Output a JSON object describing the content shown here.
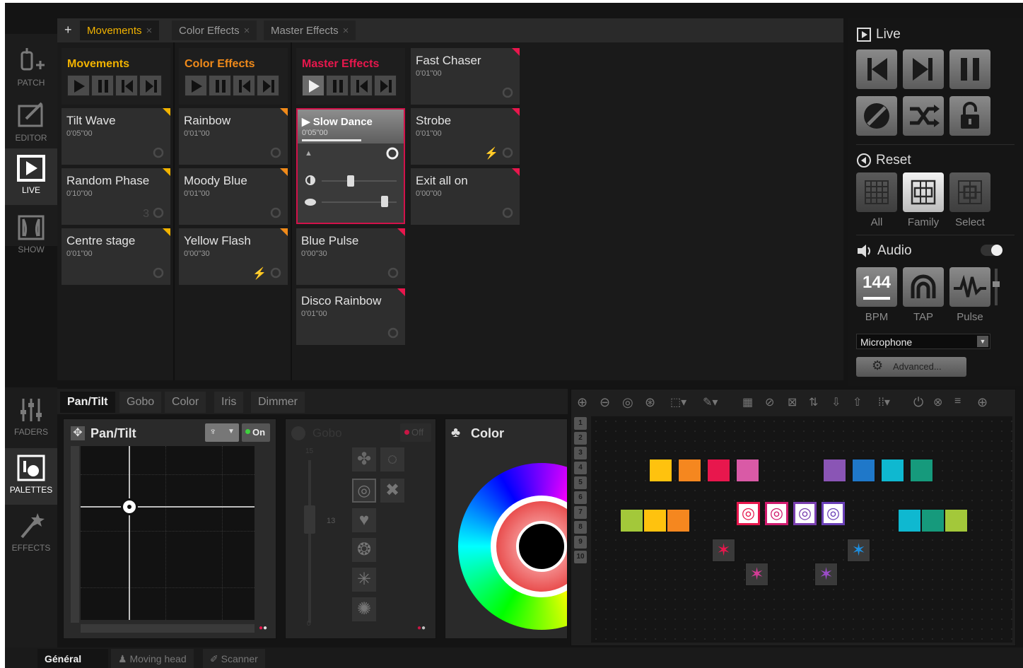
{
  "nav": {
    "top": [
      {
        "label": "PATCH",
        "icon": "patch-icon"
      },
      {
        "label": "EDITOR",
        "icon": "editor-icon"
      },
      {
        "label": "LIVE",
        "icon": "live-icon",
        "active": true
      },
      {
        "label": "SHOW",
        "icon": "show-icon"
      }
    ],
    "bottom": [
      {
        "label": "FADERS",
        "icon": "faders-icon"
      },
      {
        "label": "PALETTES",
        "icon": "palettes-icon",
        "active": true
      },
      {
        "label": "EFFECTS",
        "icon": "effects-icon"
      }
    ]
  },
  "tabs": [
    {
      "label": "Movements",
      "active": true
    },
    {
      "label": "Color Effects"
    },
    {
      "label": "Master Effects"
    }
  ],
  "add_symbol": "+",
  "close_symbol": "×",
  "columns": [
    {
      "title": "Movements",
      "color": "#f2b300",
      "cues": [
        {
          "name": "Tilt Wave",
          "duration": "0'05\"00",
          "extra": ""
        },
        {
          "name": "Random Phase",
          "duration": "0'10\"00",
          "extra": "3"
        },
        {
          "name": "Centre stage",
          "duration": "0'01\"00",
          "extra": ""
        }
      ]
    },
    {
      "title": "Color Effects",
      "color": "#f08a1a",
      "cues": [
        {
          "name": "Rainbow",
          "duration": "0'01\"00",
          "extra": ""
        },
        {
          "name": "Moody Blue",
          "duration": "0'01\"00",
          "extra": ""
        },
        {
          "name": "Yellow Flash",
          "duration": "0'00\"30",
          "extra": "⚡"
        }
      ]
    },
    {
      "title": "Master Effects",
      "color": "#e8174d",
      "active_cue": {
        "name": "Slow Dance",
        "duration": "0'05\"00"
      },
      "cues": [
        {
          "name": "Blue Pulse",
          "duration": "0'00\"30",
          "extra": ""
        },
        {
          "name": "Disco Rainbow",
          "duration": "0'01\"00",
          "extra": ""
        }
      ]
    },
    {
      "title": "",
      "color": "#e8174d",
      "cues": [
        {
          "name": "Fast Chaser",
          "duration": "0'01\"00",
          "extra": ""
        },
        {
          "name": "Strobe",
          "duration": "0'01\"00",
          "extra": "⚡"
        },
        {
          "name": "Exit all on",
          "duration": "0'00\"00",
          "extra": ""
        }
      ]
    }
  ],
  "live_panel": {
    "live_label": "Live",
    "reset_label": "Reset",
    "reset_options": [
      "All",
      "Family",
      "Select"
    ],
    "reset_selected": "Family",
    "audio_label": "Audio",
    "audio_on": true,
    "bpm_value": "144",
    "audio_buttons": [
      "BPM",
      "TAP",
      "Pulse"
    ],
    "input_source": "Microphone",
    "advanced_label": "Advanced..."
  },
  "palette_tabs": [
    "Pan/Tilt",
    "Gobo",
    "Color",
    "Iris",
    "Dimmer"
  ],
  "palette_tab_active": "Pan/Tilt",
  "pantilt": {
    "title": "Pan/Tilt",
    "toggle": "On",
    "pan": 0.28,
    "tilt": 0.35
  },
  "gobo": {
    "title": "Gobo",
    "toggle": "Off",
    "scale_top": "15",
    "scale_value": "13",
    "scale_bottom": "0"
  },
  "color_panel": {
    "title": "Color"
  },
  "fixture_rows": [
    "1",
    "2",
    "3",
    "4",
    "5",
    "6",
    "7",
    "8",
    "9",
    "10"
  ],
  "footer_tabs": [
    {
      "label": "Général",
      "active": true
    },
    {
      "label": "Moving head",
      "icon": "moving-head-icon"
    },
    {
      "label": "Scanner",
      "icon": "scanner-icon"
    }
  ],
  "colors": {
    "movements": "#f2b300",
    "color_effects": "#f08a1a",
    "master_effects": "#e8174d",
    "active_border": "#d2124a"
  }
}
